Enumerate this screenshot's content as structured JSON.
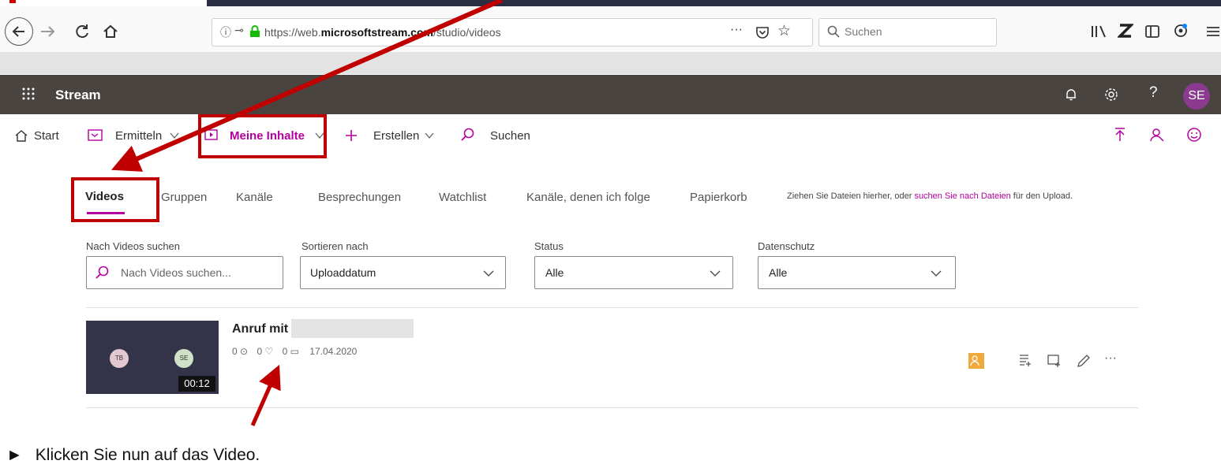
{
  "browser": {
    "url": "https://web.microsoftstream.com/studio/videos",
    "url_prefix": "https://web.",
    "url_domain": "microsoftstream.com",
    "url_path": "/studio/videos",
    "page_actions": "···",
    "search_placeholder": "Suchen"
  },
  "app": {
    "name": "Stream",
    "avatar_initials": "SE"
  },
  "commandbar": {
    "start": "Start",
    "ermitteln": "Ermitteln",
    "meine_inhalte": "Meine Inhalte",
    "erstellen": "Erstellen",
    "suchen": "Suchen"
  },
  "tabs": [
    {
      "label": "Videos",
      "active": true
    },
    {
      "label": "Gruppen"
    },
    {
      "label": "Kanäle"
    },
    {
      "label": "Besprechungen"
    },
    {
      "label": "Watchlist"
    },
    {
      "label": "Kanäle, denen ich folge"
    },
    {
      "label": "Papierkorb"
    }
  ],
  "upload_hint": {
    "before": "Ziehen Sie Dateien hierher, oder ",
    "link": "suchen Sie nach Dateien",
    "after": " für den Upload."
  },
  "filters": {
    "search": {
      "label": "Nach Videos suchen",
      "placeholder": "Nach Videos suchen..."
    },
    "sort": {
      "label": "Sortieren nach",
      "value": "Uploaddatum"
    },
    "status": {
      "label": "Status",
      "value": "Alle"
    },
    "privacy": {
      "label": "Datenschutz",
      "value": "Alle"
    }
  },
  "video": {
    "title": "Anruf mit",
    "views": "0",
    "likes": "0",
    "comments": "0",
    "date": "17.04.2020",
    "duration": "00:12",
    "participant1": "TB",
    "participant2": "SE"
  },
  "instruction": "Klicken Sie nun auf das Video.",
  "colors": {
    "accent": "#b4009e",
    "annotation_red": "#c00000",
    "header_bg": "#4a4440",
    "avatar_bg": "#8b3a8f"
  }
}
